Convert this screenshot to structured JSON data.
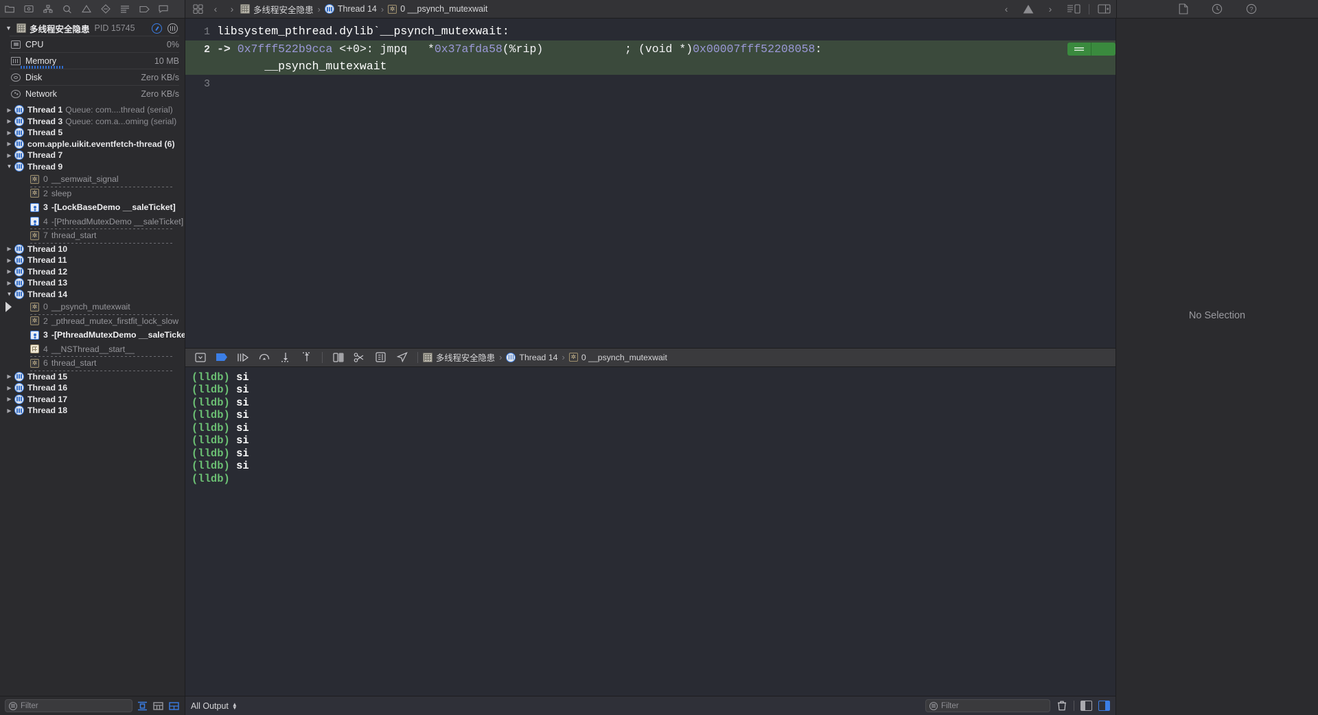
{
  "toolbar": {
    "nav_icons": [
      "folder-icon",
      "bug-icon",
      "hierarchy-icon",
      "search-icon",
      "warning-icon",
      "debug-icon",
      "report-icon",
      "tag-icon",
      "comment-icon"
    ],
    "back_label": "‹",
    "forward_label": "›",
    "breadcrumb": [
      {
        "icon": "project-icon",
        "label": "多线程安全隐患"
      },
      {
        "icon": "thread-icon",
        "label": "Thread 14"
      },
      {
        "icon": "frame-icon",
        "label": "0 __psynch_mutexwait"
      }
    ],
    "right_icons": [
      "document-icon",
      "history-icon",
      "help-icon"
    ],
    "editor_nav": {
      "prev": "‹",
      "next": "›",
      "warning": "warning-icon"
    }
  },
  "sidebar": {
    "process": {
      "name": "多线程安全隐患",
      "pid": "PID 15745",
      "disclosure": "▼",
      "buttons": [
        "pause-gauge-icon",
        "threads-gauge-icon"
      ]
    },
    "gauges": [
      {
        "icon": "cpu-icon",
        "label": "CPU",
        "value": "0%",
        "bar": false
      },
      {
        "icon": "memory-icon",
        "label": "Memory",
        "value": "10 MB",
        "bar": true
      },
      {
        "icon": "disk-icon",
        "label": "Disk",
        "value": "Zero KB/s",
        "bar": false
      },
      {
        "icon": "network-icon",
        "label": "Network",
        "value": "Zero KB/s",
        "bar": false
      }
    ],
    "threads": [
      {
        "type": "thread",
        "state": "collapsed",
        "label": "Thread 1",
        "queue": "Queue: com....thread (serial)"
      },
      {
        "type": "thread",
        "state": "collapsed",
        "label": "Thread 3",
        "queue": "Queue: com.a...oming (serial)"
      },
      {
        "type": "thread",
        "state": "collapsed",
        "label": "Thread 5",
        "queue": ""
      },
      {
        "type": "thread",
        "state": "collapsed",
        "label": "com.apple.uikit.eventfetch-thread (6)",
        "queue": ""
      },
      {
        "type": "thread",
        "state": "collapsed",
        "label": "Thread 7",
        "queue": ""
      },
      {
        "type": "thread",
        "state": "expanded",
        "label": "Thread 9",
        "queue": "",
        "frames": [
          {
            "icon": "gear-icon",
            "num": "0",
            "text": "__semwait_signal",
            "style": "dim",
            "rule": "none"
          },
          {
            "icon": "gear-icon",
            "num": "2",
            "text": "sleep",
            "style": "dim",
            "rule": "dashed"
          },
          {
            "icon": "user-icon",
            "num": "3",
            "text": "-[LockBaseDemo __saleTicket]",
            "style": "user",
            "rule": "none"
          },
          {
            "icon": "user-icon",
            "num": "4",
            "text": "-[PthreadMutexDemo __saleTicket]",
            "style": "dim",
            "rule": "none"
          },
          {
            "icon": "gear-icon",
            "num": "7",
            "text": "thread_start",
            "style": "dim",
            "rule": "dashed-bottom"
          }
        ]
      },
      {
        "type": "thread",
        "state": "collapsed",
        "label": "Thread 10",
        "queue": ""
      },
      {
        "type": "thread",
        "state": "collapsed",
        "label": "Thread 11",
        "queue": ""
      },
      {
        "type": "thread",
        "state": "collapsed",
        "label": "Thread 12",
        "queue": ""
      },
      {
        "type": "thread",
        "state": "collapsed",
        "label": "Thread 13",
        "queue": ""
      },
      {
        "type": "thread",
        "state": "expanded",
        "label": "Thread 14",
        "queue": "",
        "current": true,
        "frames": [
          {
            "icon": "gear-icon",
            "num": "0",
            "text": "__psynch_mutexwait",
            "style": "dim",
            "rule": "none",
            "current": true
          },
          {
            "icon": "gear-icon",
            "num": "2",
            "text": "_pthread_mutex_firstfit_lock_slow",
            "style": "dim",
            "rule": "dashed"
          },
          {
            "icon": "user-icon",
            "num": "3",
            "text": "-[PthreadMutexDemo __saleTicket]",
            "style": "user",
            "rule": "none"
          },
          {
            "icon": "grid-icon",
            "num": "4",
            "text": "__NSThread__start__",
            "style": "dim",
            "rule": "none"
          },
          {
            "icon": "gear-icon",
            "num": "6",
            "text": "thread_start",
            "style": "dim",
            "rule": "dashed-bottom"
          }
        ]
      },
      {
        "type": "thread",
        "state": "collapsed",
        "label": "Thread 15",
        "queue": ""
      },
      {
        "type": "thread",
        "state": "collapsed",
        "label": "Thread 16",
        "queue": ""
      },
      {
        "type": "thread",
        "state": "collapsed",
        "label": "Thread 17",
        "queue": ""
      },
      {
        "type": "thread",
        "state": "collapsed",
        "label": "Thread 18",
        "queue": ""
      }
    ],
    "footer": {
      "filter_placeholder": "Filter",
      "buttons": [
        "show-all-threads-icon",
        "show-queues-icon",
        "show-frames-icon"
      ]
    }
  },
  "editor": {
    "lines": [
      {
        "num": "1",
        "highlight": false,
        "segments": [
          {
            "text": "libsystem_pthread.dylib`__psynch_mutexwait:",
            "cls": "tok-white"
          }
        ]
      },
      {
        "num": "2",
        "highlight": true,
        "segments": [
          {
            "text": "-> ",
            "cls": "tok-arrow"
          },
          {
            "text": "0x7fff522b9cca ",
            "cls": "tok-addr"
          },
          {
            "text": "<+0>: jmpq   *",
            "cls": "tok-plain"
          },
          {
            "text": "0x37afda58",
            "cls": "tok-addr"
          },
          {
            "text": "(%rip)            ; (void *)",
            "cls": "tok-plain"
          },
          {
            "text": "0x00007fff52208058",
            "cls": "tok-addr"
          },
          {
            "text": ":",
            "cls": "tok-plain"
          }
        ],
        "continuation": "__psynch_mutexwait"
      },
      {
        "num": "3",
        "highlight": false,
        "segments": []
      }
    ],
    "badge_label": "="
  },
  "debugbar": {
    "buttons": [
      "hide-debug-area-icon",
      "breakpoints-icon",
      "continue-icon",
      "step-over-icon",
      "step-into-icon",
      "step-out-icon",
      "view-hierarchy-icon",
      "memory-graph-icon",
      "environment-overrides-icon",
      "location-simulate-icon"
    ],
    "breadcrumb": [
      {
        "icon": "project-icon",
        "label": "多线程安全隐患"
      },
      {
        "icon": "thread-icon",
        "label": "Thread 14"
      },
      {
        "icon": "frame-icon",
        "label": "0 __psynch_mutexwait"
      }
    ]
  },
  "console": {
    "lines": [
      {
        "prompt": "(lldb)",
        "cmd": "si"
      },
      {
        "prompt": "(lldb)",
        "cmd": "si"
      },
      {
        "prompt": "(lldb)",
        "cmd": "si"
      },
      {
        "prompt": "(lldb)",
        "cmd": "si"
      },
      {
        "prompt": "(lldb)",
        "cmd": "si"
      },
      {
        "prompt": "(lldb)",
        "cmd": "si"
      },
      {
        "prompt": "(lldb)",
        "cmd": "si"
      },
      {
        "prompt": "(lldb)",
        "cmd": "si"
      },
      {
        "prompt": "(lldb)",
        "cmd": ""
      }
    ]
  },
  "statusbar": {
    "output_filter_label": "All Output",
    "filter_placeholder": "Filter",
    "buttons": [
      "clear-console-icon",
      "show-variables-pane-icon",
      "show-console-pane-icon"
    ]
  },
  "inspector": {
    "empty_label": "No Selection"
  },
  "colors": {
    "accent_blue": "#3b7ee6",
    "highlight_green": "#3b4a3c",
    "badge_green": "#3a8a3e",
    "console_prompt_green": "#6bbf73",
    "addr_purple": "#9a98d6",
    "bg_editor": "#292b33",
    "bg_chrome": "#2b2b2e"
  }
}
